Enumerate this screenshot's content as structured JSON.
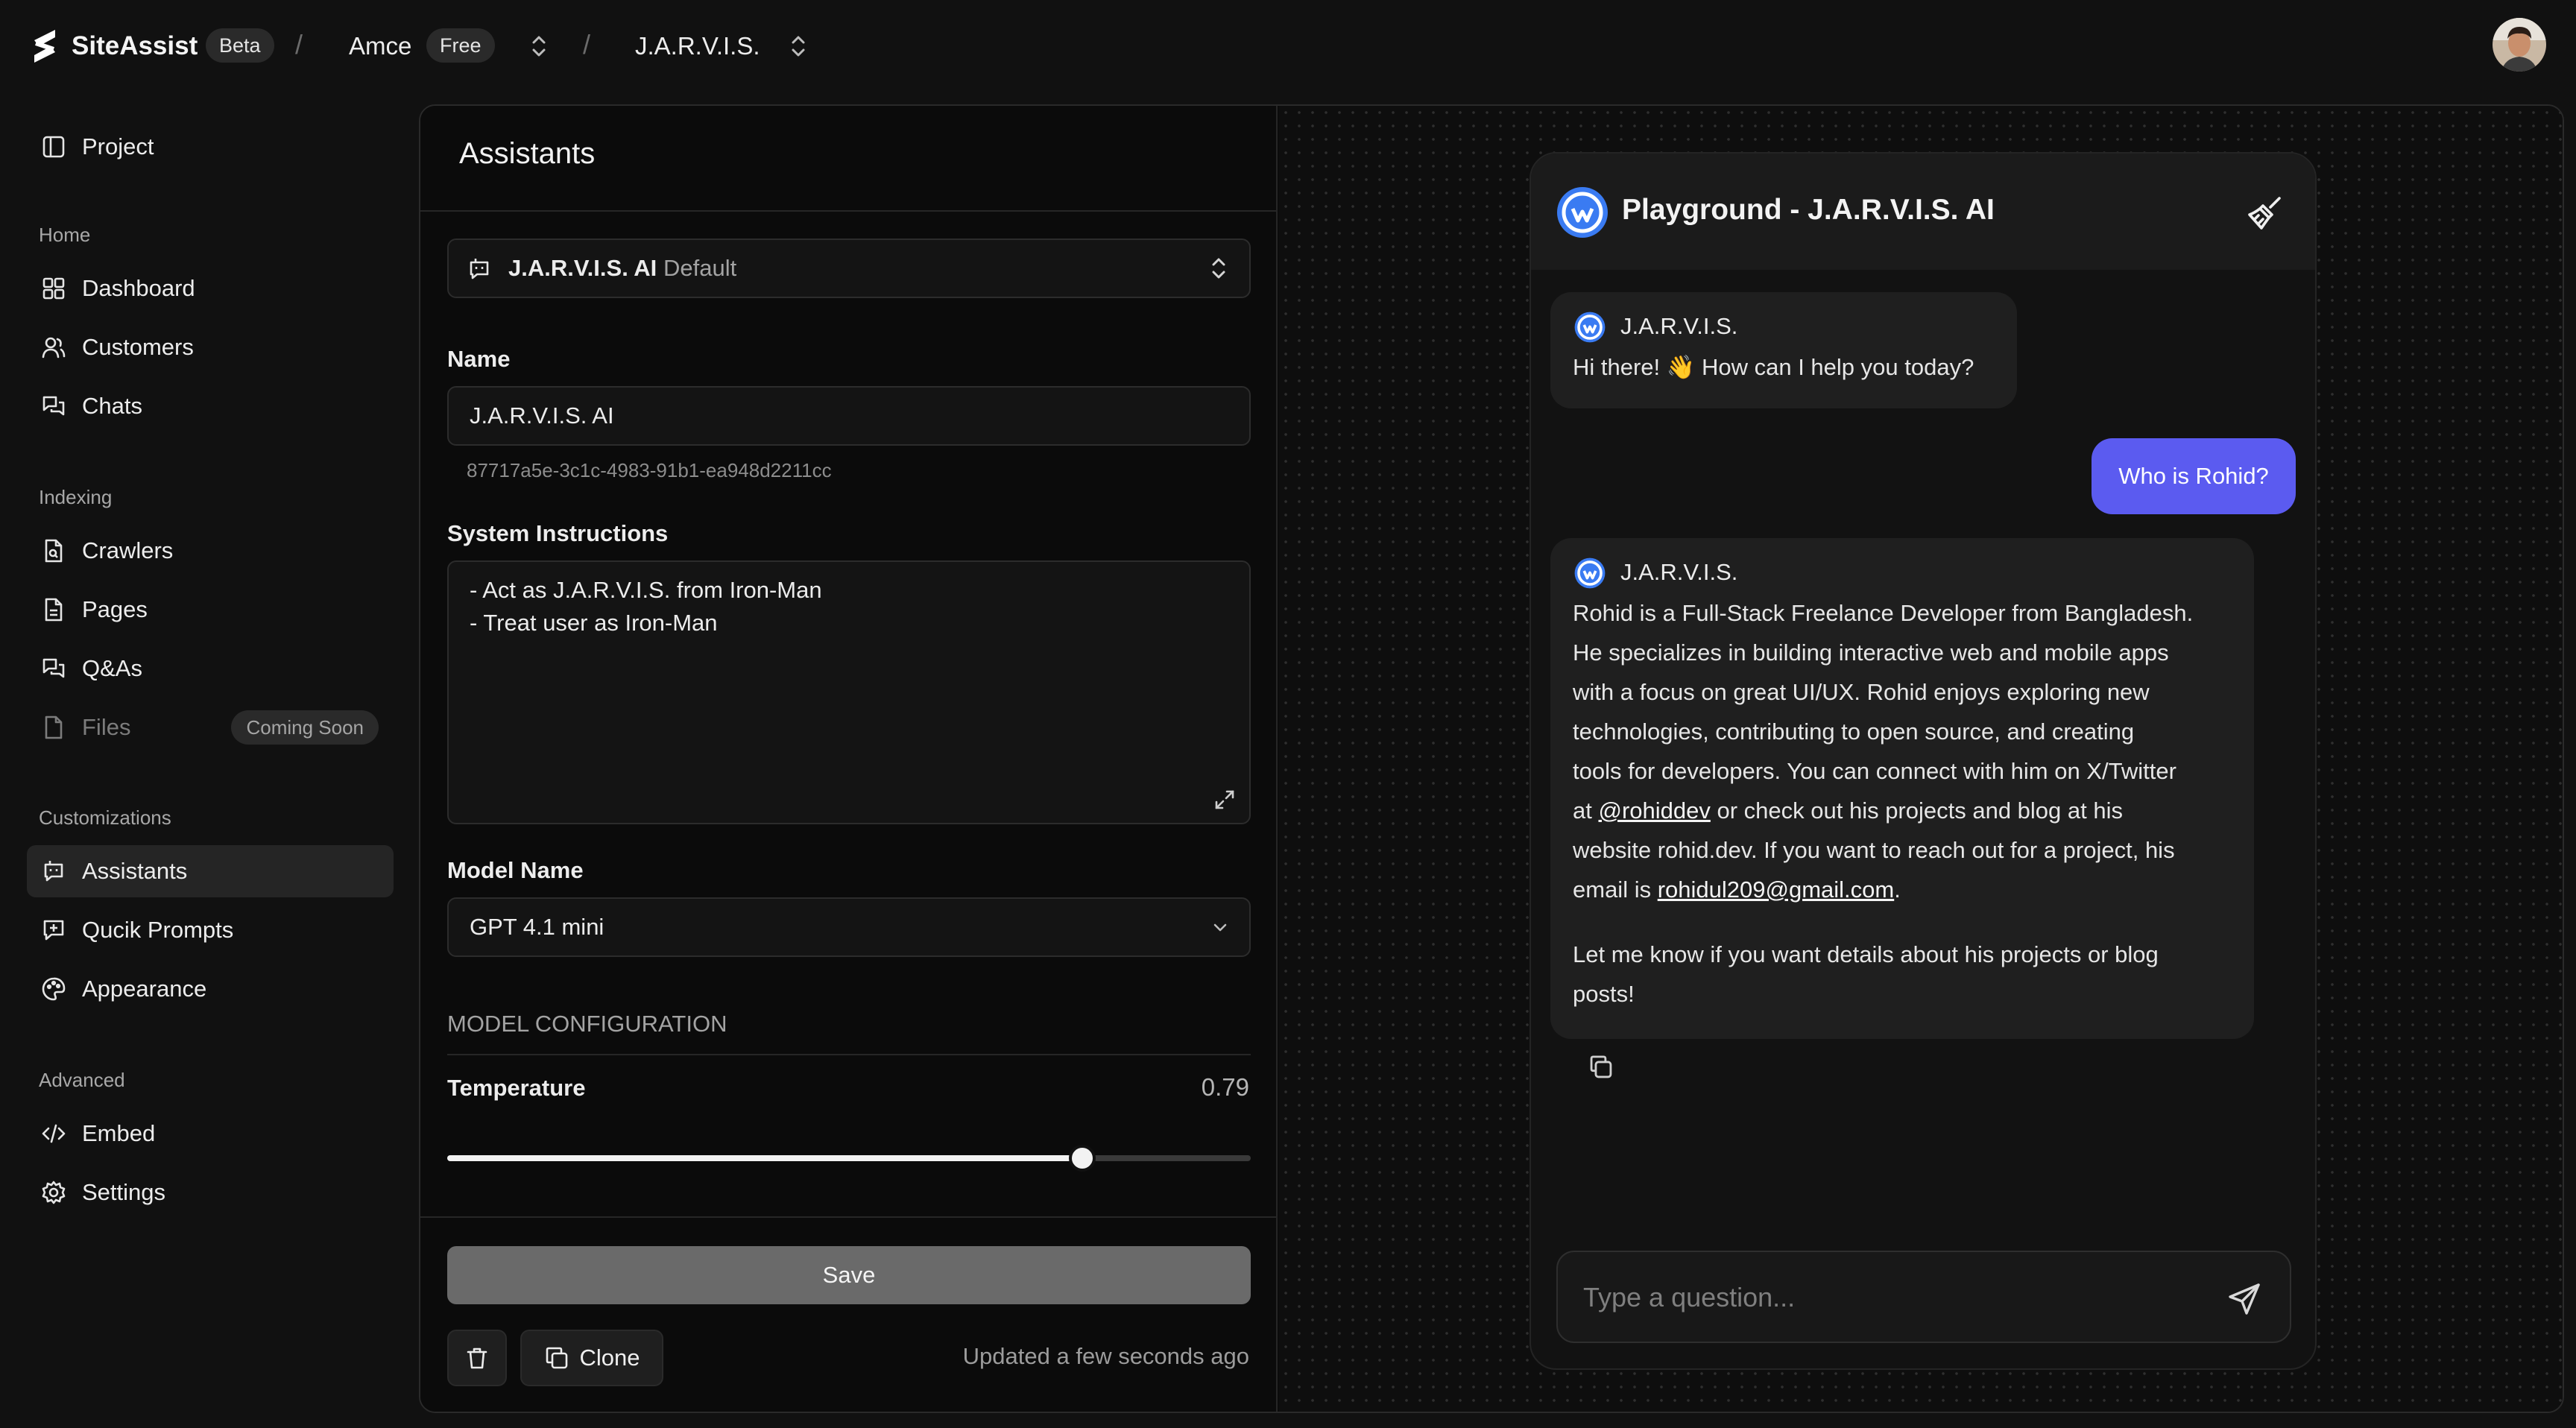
{
  "topbar": {
    "brand": "SiteAssist",
    "brand_badge": "Beta",
    "org": "Amce",
    "org_plan": "Free",
    "project": "J.A.R.V.I.S.",
    "sep": "/"
  },
  "sidebar": {
    "project_label": "Project",
    "sections": {
      "home": "Home",
      "indexing": "Indexing",
      "customizations": "Customizations",
      "advanced": "Advanced"
    },
    "items": {
      "dashboard": "Dashboard",
      "customers": "Customers",
      "chats": "Chats",
      "crawlers": "Crawlers",
      "pages": "Pages",
      "qas": "Q&As",
      "files": "Files",
      "files_badge": "Coming Soon",
      "assistants": "Assistants",
      "prompts": "Qucik Prompts",
      "appearance": "Appearance",
      "embed": "Embed",
      "settings": "Settings"
    }
  },
  "assistant_panel": {
    "title": "Assistants",
    "selector_name": "J.A.R.V.I.S. AI",
    "selector_tag": "Default",
    "name_label": "Name",
    "name_value": "J.A.R.V.I.S. AI",
    "assistant_id": "87717a5e-3c1c-4983-91b1-ea948d2211cc",
    "instructions_label": "System Instructions",
    "instructions_line1": "- Act as J.A.R.V.I.S. from Iron-Man",
    "instructions_line2": "- Treat user as Iron-Man",
    "model_label": "Model Name",
    "model_value": "GPT 4.1 mini",
    "config_heading": "MODEL CONFIGURATION",
    "temperature_label": "Temperature",
    "temperature_value": "0.79",
    "temperature_fraction": 0.79,
    "save_label": "Save",
    "clone_label": "Clone",
    "updated_text": "Updated a few seconds ago"
  },
  "playground": {
    "title": "Playground - J.A.R.V.I.S. AI",
    "bot_name": "J.A.R.V.I.S.",
    "greeting": "Hi there! 👋 How can I help you today?",
    "user_message": "Who is Rohid?",
    "reply": {
      "l1": "Rohid is a Full-Stack Freelance Developer from Bangladesh.",
      "l2": "He specializes in building interactive web and mobile apps",
      "l3": "with a focus on great UI/UX. Rohid enjoys exploring new",
      "l4": "technologies, contributing to open source, and creating",
      "l5": "tools for developers. You can connect with him on X/Twitter",
      "l6_pre": "at ",
      "l6_link": "@rohiddev",
      "l6_post": " or check out his projects and blog at his",
      "l7": "website rohid.dev. If you want to reach out for a project, his",
      "l8_pre": "email is ",
      "l8_link": "rohidul209@gmail.com",
      "l8_post": ".",
      "p2_l1": "Let me know if you want details about his projects or blog",
      "p2_l2": "posts!"
    },
    "input_placeholder": "Type a question..."
  },
  "colors": {
    "accent": "#5b5bf0",
    "bot_avatar": "#3a7bf2",
    "background": "#111111"
  }
}
